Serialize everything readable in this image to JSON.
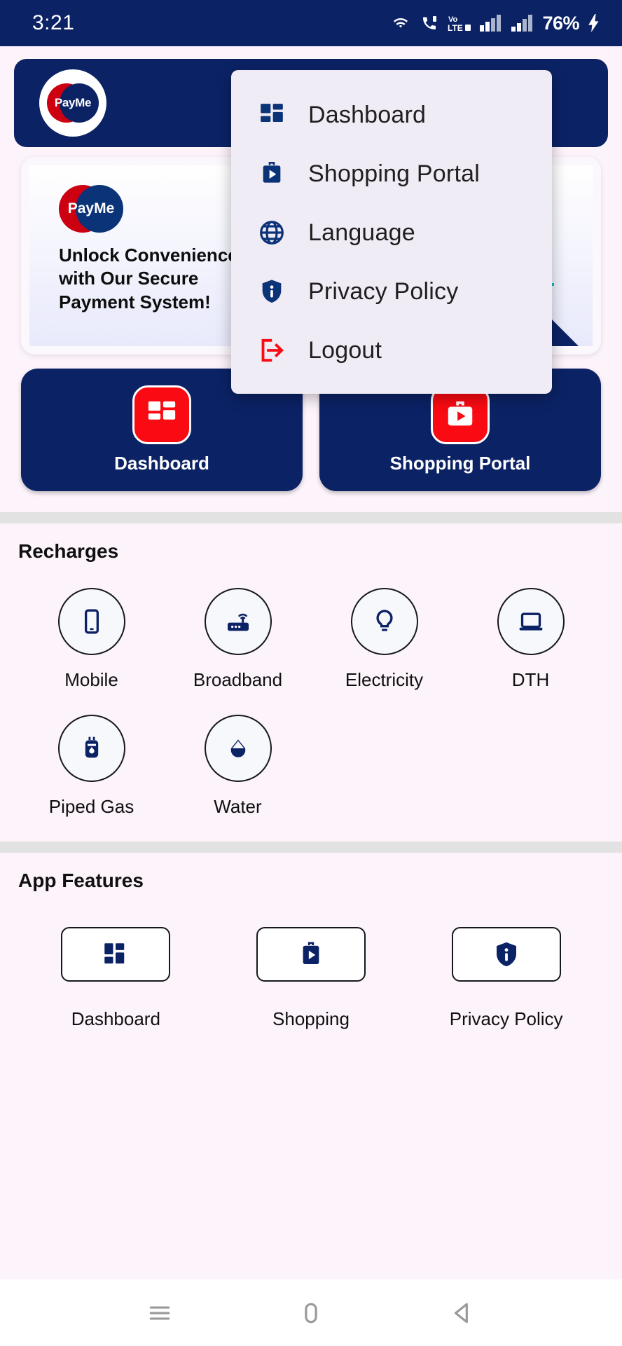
{
  "statusbar": {
    "time": "3:21",
    "battery": "76%",
    "icons": [
      "wifi-icon",
      "call-signal-icon",
      "volte2-icon",
      "signal-bars-1-icon",
      "signal-bars-2-icon",
      "charging-bolt-icon"
    ]
  },
  "header": {
    "logo_text": "PayMe"
  },
  "banner": {
    "logo_text": "PayMe",
    "headline": "Unlock Convenience with Our Secure Payment System!"
  },
  "quick_tiles": [
    {
      "label": "Dashboard",
      "icon": "dashboard-grid-icon"
    },
    {
      "label": "Shopping Portal",
      "icon": "shopping-bag-play-icon"
    }
  ],
  "menu": {
    "items": [
      {
        "label": "Dashboard",
        "icon": "dashboard-grid-icon",
        "color": "#0b3377"
      },
      {
        "label": "Shopping Portal",
        "icon": "shopping-bag-play-icon",
        "color": "#0b3377"
      },
      {
        "label": "Language",
        "icon": "globe-icon",
        "color": "#0b3377"
      },
      {
        "label": "Privacy Policy",
        "icon": "shield-info-icon",
        "color": "#0b3377"
      },
      {
        "label": "Logout",
        "icon": "logout-arrow-icon",
        "color": "#fa0a12"
      }
    ]
  },
  "recharges": {
    "title": "Recharges",
    "items": [
      {
        "label": "Mobile",
        "icon": "mobile-phone-icon"
      },
      {
        "label": "Broadband",
        "icon": "router-wifi-icon"
      },
      {
        "label": "Electricity",
        "icon": "light-bulb-icon"
      },
      {
        "label": "DTH",
        "icon": "tv-laptop-icon"
      },
      {
        "label": "Piped Gas",
        "icon": "gas-cylinder-icon"
      },
      {
        "label": "Water",
        "icon": "water-drop-icon"
      }
    ]
  },
  "app_features": {
    "title": "App Features",
    "items": [
      {
        "label": "Dashboard",
        "icon": "dashboard-grid-icon"
      },
      {
        "label": "Shopping",
        "icon": "shopping-bag-play-icon"
      },
      {
        "label": "Privacy Policy",
        "icon": "shield-info-icon"
      }
    ]
  },
  "navbar": {
    "buttons": [
      "recents-icon",
      "home-icon",
      "back-icon"
    ]
  },
  "colors": {
    "primary_navy": "#0b2265",
    "accent_red": "#fa0a12",
    "page_bg": "#fcf3fb",
    "menu_bg": "#f0ecf5"
  }
}
